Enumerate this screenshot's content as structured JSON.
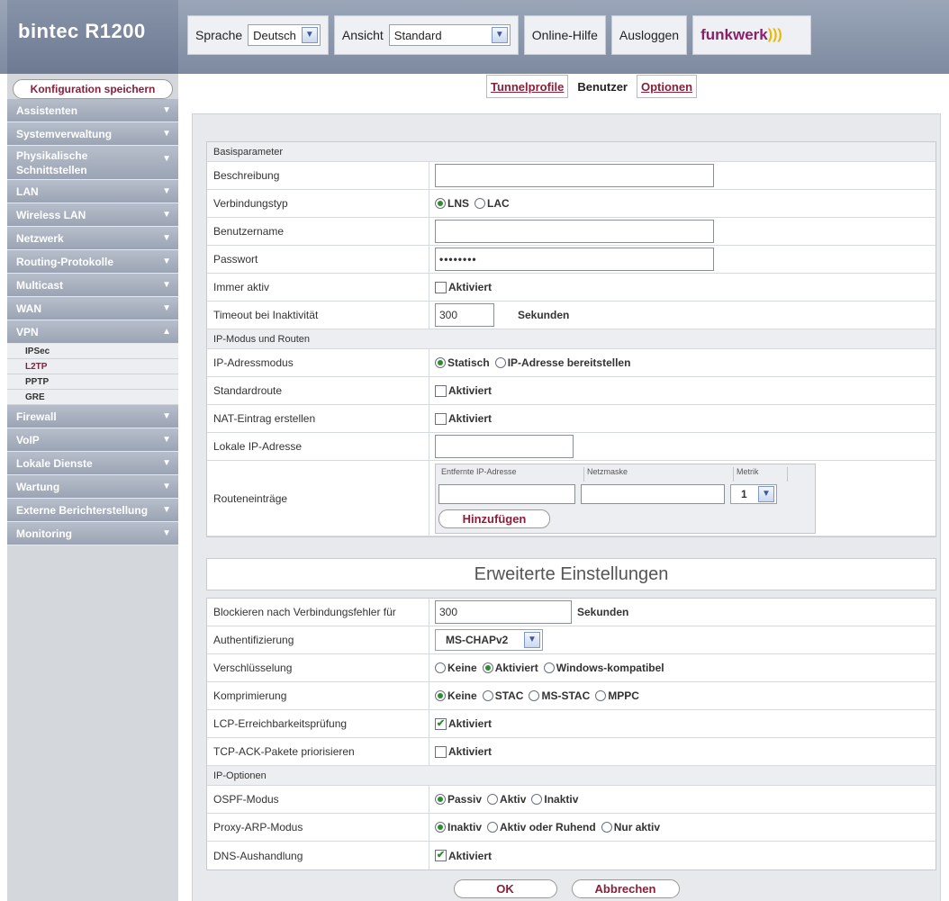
{
  "brand": {
    "name": "bintec R1200",
    "logo": "funkwerk",
    "accent_color": "#8a1f6a"
  },
  "toolbar": {
    "language_label": "Sprache",
    "language_value": "Deutsch",
    "view_label": "Ansicht",
    "view_value": "Standard",
    "help_label": "Online-Hilfe",
    "logout_label": "Ausloggen"
  },
  "sidebar": {
    "save_label": "Konfiguration speichern",
    "items": [
      {
        "label": "Assistenten"
      },
      {
        "label": "Systemverwaltung"
      },
      {
        "label": "Physikalische Schnittstellen"
      },
      {
        "label": "LAN"
      },
      {
        "label": "Wireless LAN"
      },
      {
        "label": "Netzwerk"
      },
      {
        "label": "Routing-Protokolle"
      },
      {
        "label": "Multicast"
      },
      {
        "label": "WAN"
      },
      {
        "label": "VPN"
      },
      {
        "label": "Firewall"
      },
      {
        "label": "VoIP"
      },
      {
        "label": "Lokale Dienste"
      },
      {
        "label": "Wartung"
      },
      {
        "label": "Externe Berichterstellung"
      },
      {
        "label": "Monitoring"
      }
    ],
    "vpn_sub": [
      {
        "label": "IPSec"
      },
      {
        "label": "L2TP"
      },
      {
        "label": "PPTP"
      },
      {
        "label": "GRE"
      }
    ]
  },
  "tabs": [
    {
      "label": "Tunnelprofile"
    },
    {
      "label": "Benutzer"
    },
    {
      "label": "Optionen"
    }
  ],
  "basic": {
    "section": "Basisparameter",
    "description_label": "Beschreibung",
    "description_value": "",
    "conn_type_label": "Verbindungstyp",
    "conn_type_opt1": "LNS",
    "conn_type_opt2": "LAC",
    "username_label": "Benutzername",
    "username_value": "",
    "password_label": "Passwort",
    "password_value": "••••••••",
    "always_active_label": "Immer aktiv",
    "checkbox_text": "Aktiviert",
    "timeout_label": "Timeout bei Inaktivität",
    "timeout_value": "300",
    "seconds": "Sekunden"
  },
  "ip": {
    "section": "IP-Modus und Routen",
    "ip_mode_label": "IP-Adressmodus",
    "ip_mode_opt1": "Statisch",
    "ip_mode_opt2": "IP-Adresse bereitstellen",
    "default_route_label": "Standardroute",
    "nat_label": "NAT-Eintrag erstellen",
    "local_ip_label": "Lokale IP-Adresse",
    "local_ip_value": "",
    "route_entries_label": "Routeneinträge",
    "col_remote": "Entfernte IP-Adresse",
    "col_netmask": "Netzmaske",
    "col_metric": "Metrik",
    "metric_value": "1",
    "add_label": "Hinzufügen"
  },
  "advanced": {
    "title": "Erweiterte Einstellungen",
    "block_label": "Blockieren nach Verbindungsfehler für",
    "block_value": "300",
    "auth_label": "Authentifizierung",
    "auth_value": "MS-CHAPv2",
    "enc_label": "Verschlüsselung",
    "enc_opt1": "Keine",
    "enc_opt2": "Aktiviert",
    "enc_opt3": "Windows-kompatibel",
    "comp_label": "Komprimierung",
    "comp_opt1": "Keine",
    "comp_opt2": "STAC",
    "comp_opt3": "MS-STAC",
    "comp_opt4": "MPPC",
    "lcp_label": "LCP-Erreichbarkeitsprüfung",
    "tcp_label": "TCP-ACK-Pakete priorisieren",
    "ip_options_section": "IP-Optionen",
    "ospf_label": "OSPF-Modus",
    "ospf_opt1": "Passiv",
    "ospf_opt2": "Aktiv",
    "ospf_opt3": "Inaktiv",
    "proxy_label": "Proxy-ARP-Modus",
    "proxy_opt1": "Inaktiv",
    "proxy_opt2": "Aktiv oder Ruhend",
    "proxy_opt3": "Nur aktiv",
    "dns_label": "DNS-Aushandlung"
  },
  "buttons": {
    "ok": "OK",
    "cancel": "Abbrechen"
  }
}
